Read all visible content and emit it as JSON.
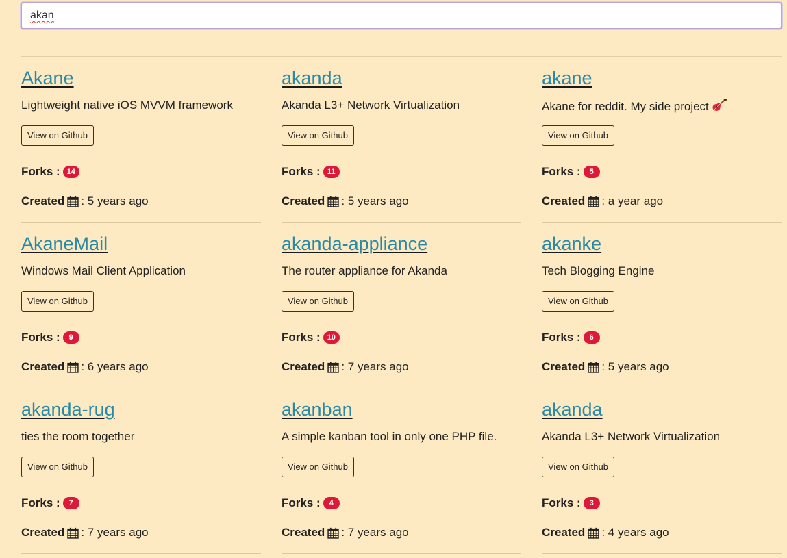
{
  "search": {
    "value": "akan"
  },
  "labels": {
    "view_button": "View on Github",
    "forks": "Forks :",
    "created": "Created",
    "created_sep": ":"
  },
  "repos": [
    {
      "title": "Akane",
      "desc": "Lightweight native iOS MVVM framework",
      "forks": "14",
      "created": "5 years ago"
    },
    {
      "title": "akanda",
      "desc": "Akanda L3+ Network Virtualization",
      "forks": "11",
      "created": "5 years ago"
    },
    {
      "title": "akane",
      "desc": "Akane for reddit. My side project",
      "desc_emoji": "guitar-icon",
      "forks": "5",
      "created": "a year ago"
    },
    {
      "title": "AkaneMail",
      "desc": "Windows Mail Client Application",
      "forks": "9",
      "created": "6 years ago"
    },
    {
      "title": "akanda-appliance",
      "desc": "The router appliance for Akanda",
      "forks": "10",
      "created": "7 years ago"
    },
    {
      "title": "akanke",
      "desc": "Tech Blogging Engine",
      "forks": "6",
      "created": "5 years ago"
    },
    {
      "title": "akanda-rug",
      "desc": "ties the room together",
      "forks": "7",
      "created": "7 years ago"
    },
    {
      "title": "akanban",
      "desc": "A simple kanban tool in only one PHP file.",
      "forks": "4",
      "created": "7 years ago"
    },
    {
      "title": "akanda",
      "desc": "Akanda L3+ Network Virtualization",
      "forks": "3",
      "created": "4 years ago"
    }
  ],
  "colors": {
    "background": "#fde9c2",
    "link": "#2a8aa5",
    "badge": "#dc1a38"
  }
}
